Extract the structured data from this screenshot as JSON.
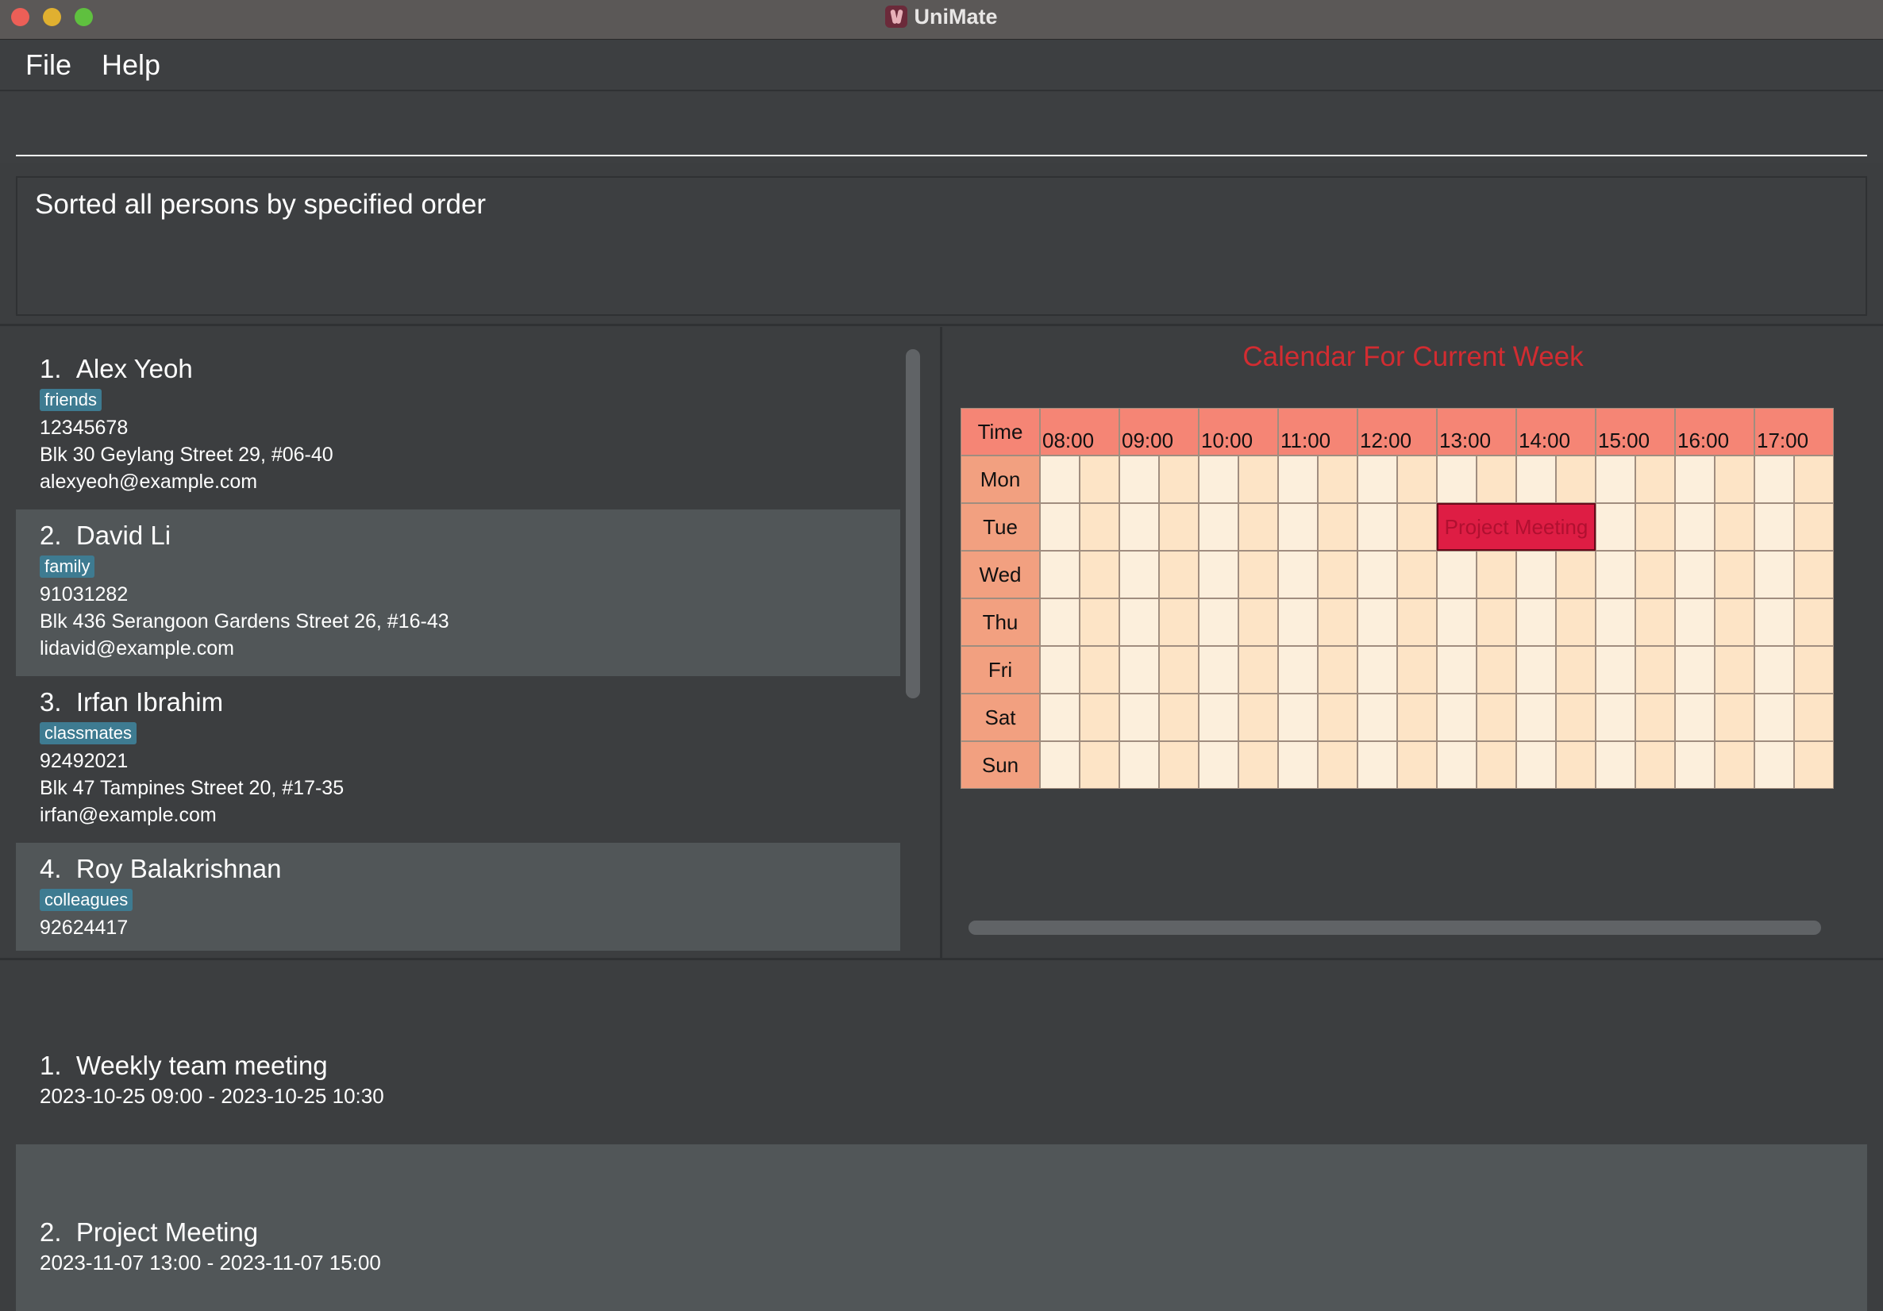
{
  "window": {
    "title": "UniMate",
    "app_icon": "unimate-logo"
  },
  "menu": {
    "items": [
      "File",
      "Help"
    ]
  },
  "command": {
    "value": "",
    "placeholder": ""
  },
  "result": {
    "text": "Sorted all persons by specified order"
  },
  "persons": [
    {
      "index": "1.",
      "name": "Alex Yeoh",
      "tag": "friends",
      "phone": "12345678",
      "address": "Blk 30 Geylang Street 29, #06-40",
      "email": "alexyeoh@example.com"
    },
    {
      "index": "2.",
      "name": "David Li",
      "tag": "family",
      "phone": "91031282",
      "address": "Blk 436 Serangoon Gardens Street 26, #16-43",
      "email": "lidavid@example.com"
    },
    {
      "index": "3.",
      "name": "Irfan Ibrahim",
      "tag": "classmates",
      "phone": "92492021",
      "address": "Blk 47 Tampines Street 20, #17-35",
      "email": "irfan@example.com"
    },
    {
      "index": "4.",
      "name": "Roy Balakrishnan",
      "tag": "colleagues",
      "phone": "92624417",
      "address": "",
      "email": ""
    }
  ],
  "calendar": {
    "title": "Calendar For Current Week",
    "time_header": "Time",
    "hours": [
      "08:00",
      "09:00",
      "10:00",
      "11:00",
      "12:00",
      "13:00",
      "14:00",
      "15:00",
      "16:00",
      "17:00"
    ],
    "days": [
      "Mon",
      "Tue",
      "Wed",
      "Thu",
      "Fri",
      "Sat",
      "Sun"
    ],
    "events": [
      {
        "label": "Project Meeting",
        "day": "Tue",
        "start": "13:00",
        "end": "15:00"
      }
    ],
    "colors": {
      "header": "#f58575",
      "day": "#f2a080",
      "slot_a": "#fcefdc",
      "slot_b": "#fde4c6",
      "event": "#de1d44",
      "title": "#d22c31"
    }
  },
  "events": [
    {
      "index": "1.",
      "name": "Weekly team meeting",
      "time": "2023-10-25 09:00 - 2023-10-25 10:30"
    },
    {
      "index": "2.",
      "name": "Project Meeting",
      "time": "2023-11-07 13:00 - 2023-11-07 15:00"
    }
  ]
}
